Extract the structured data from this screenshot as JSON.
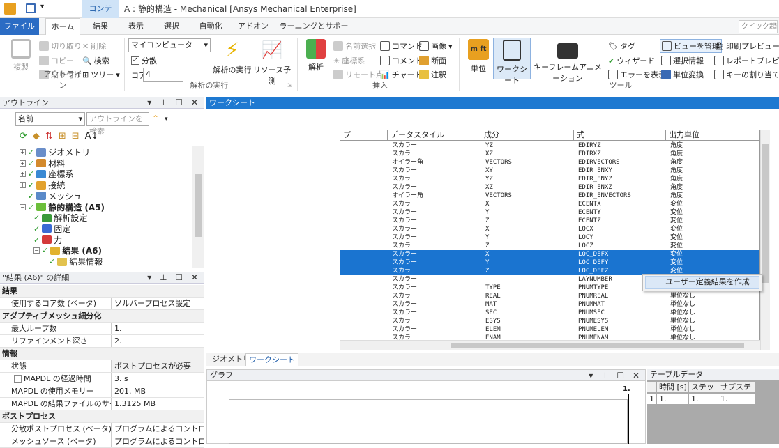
{
  "window": {
    "context_tab": "コンテキ...",
    "title": "A : 静的構造 - Mechanical [Ansys Mechanical Enterprise]"
  },
  "menu": {
    "tabs": [
      "ファイル",
      "ホーム",
      "結果",
      "表示",
      "選択",
      "自動化",
      "アドオン",
      "ラーニングとサポート"
    ],
    "active": "ホーム",
    "search_placeholder": "クイック起動"
  },
  "ribbon": {
    "outline": {
      "duplicate": "複製",
      "cut": "切り取り",
      "copy": "コピー",
      "paste": "貼り付け",
      "delete": "削除",
      "find": "検索",
      "tree": "ツリー",
      "group": "アウトライン"
    },
    "solve": {
      "target": "マイコンピュータ",
      "distributed": "分散",
      "cores_label": "コア",
      "cores": "4",
      "solve_btn": "解析の実行",
      "resource_btn": "リソース予測",
      "group": "解析の実行"
    },
    "insert": {
      "analysis": "解析",
      "named_sel": "名前選択",
      "coord": "座標系",
      "remote": "リモート点",
      "command": "コマンド",
      "comment": "コメント",
      "chart": "チャート",
      "image": "画像",
      "section": "断面",
      "annotation": "注釈",
      "group": "挿入"
    },
    "tools": {
      "unit": "単位",
      "worksheet": "ワークシート",
      "keyframe": "キーフレームアニメーション",
      "tag": "タグ",
      "wizard": "ウィザード",
      "show_errors": "エラーを表示",
      "manage_views": "ビューを管理",
      "sel_info": "選択情報",
      "unit_convert": "単位変換",
      "print_preview": "印刷プレビュー",
      "report_preview": "レポートプレビュー",
      "key_assign": "キーの割り当て",
      "group": "ツール"
    }
  },
  "outline": {
    "title": "アウトライン",
    "name_filter": "名前",
    "search_placeholder": "アウトラインを検索",
    "tree": [
      {
        "label": "ジオメトリ",
        "level": 1,
        "bold": false,
        "icon_color": "#6a8ec9"
      },
      {
        "label": "材料",
        "level": 1,
        "bold": false,
        "icon_color": "#d48a2c"
      },
      {
        "label": "座標系",
        "level": 1,
        "bold": false,
        "icon_color": "#3a8ad4"
      },
      {
        "label": "接続",
        "level": 1,
        "bold": false,
        "icon_color": "#e2a22e"
      },
      {
        "label": "メッシュ",
        "level": 1,
        "bold": false,
        "icon_color": "#5a8ac9"
      },
      {
        "label": "静的構造 (A5)",
        "level": 1,
        "bold": true,
        "icon_color": "#6cbf3a"
      },
      {
        "label": "解析設定",
        "level": 2,
        "bold": false,
        "icon_color": "#3a9a3a"
      },
      {
        "label": "固定",
        "level": 2,
        "bold": false,
        "icon_color": "#3a6ad4"
      },
      {
        "label": "力",
        "level": 2,
        "bold": false,
        "icon_color": "#d43a3a"
      },
      {
        "label": "結果 (A6)",
        "level": 2,
        "bold": true,
        "icon_color": "#e2b22e"
      },
      {
        "label": "結果情報",
        "level": 3,
        "bold": false,
        "icon_color": "#e2c24e"
      }
    ]
  },
  "details": {
    "title": "\"結果 (A6)\" の詳細",
    "rows": [
      {
        "type": "sec",
        "label": "結果"
      },
      {
        "type": "row",
        "k": "使用するコア数 (ベータ)",
        "v": "ソルバープロセス設定"
      },
      {
        "type": "sec",
        "label": "アダプティブメッシュ細分化"
      },
      {
        "type": "row",
        "k": "最大ループ数",
        "v": "1."
      },
      {
        "type": "row",
        "k": "リファインメント深さ",
        "v": "2."
      },
      {
        "type": "sec",
        "label": "情報"
      },
      {
        "type": "row",
        "k": "状態",
        "v": "ポストプロセスが必要",
        "hl": true
      },
      {
        "type": "row",
        "k": "MAPDL の経過時間",
        "v": "3. s",
        "check": true
      },
      {
        "type": "row",
        "k": "MAPDL の使用メモリー",
        "v": "201. MB"
      },
      {
        "type": "row",
        "k": "MAPDL の結果ファイルのサイズ",
        "v": "1.3125 MB"
      },
      {
        "type": "sec",
        "label": "ポストプロセス"
      },
      {
        "type": "row",
        "k": "分散ポストプロセス (ベータ)",
        "v": "プログラムによるコントロール"
      },
      {
        "type": "row",
        "k": "メッシュソース (ベータ)",
        "v": "プログラムによるコントロール"
      }
    ]
  },
  "worksheet": {
    "title": "ワークシート",
    "columns": [
      "プ",
      "データスタイル",
      "成分",
      "式",
      "出力単位"
    ],
    "rows": [
      {
        "style": "スカラー",
        "comp": "YZ",
        "expr": "EDIRYZ",
        "unit": "角度"
      },
      {
        "style": "スカラー",
        "comp": "XZ",
        "expr": "EDIRXZ",
        "unit": "角度"
      },
      {
        "style": "オイラー角",
        "comp": "VECTORS",
        "expr": "EDIRVECTORS",
        "unit": "角度"
      },
      {
        "style": "スカラー",
        "comp": "XY",
        "expr": "EDIR_ENXY",
        "unit": "角度"
      },
      {
        "style": "スカラー",
        "comp": "YZ",
        "expr": "EDIR_ENYZ",
        "unit": "角度"
      },
      {
        "style": "スカラー",
        "comp": "XZ",
        "expr": "EDIR_ENXZ",
        "unit": "角度"
      },
      {
        "style": "オイラー角",
        "comp": "VECTORS",
        "expr": "EDIR_ENVECTORS",
        "unit": "角度"
      },
      {
        "style": "スカラー",
        "comp": "X",
        "expr": "ECENTX",
        "unit": "変位"
      },
      {
        "style": "スカラー",
        "comp": "Y",
        "expr": "ECENTY",
        "unit": "変位"
      },
      {
        "style": "スカラー",
        "comp": "Z",
        "expr": "ECENTZ",
        "unit": "変位"
      },
      {
        "style": "スカラー",
        "comp": "X",
        "expr": "LOCX",
        "unit": "変位"
      },
      {
        "style": "スカラー",
        "comp": "Y",
        "expr": "LOCY",
        "unit": "変位"
      },
      {
        "style": "スカラー",
        "comp": "Z",
        "expr": "LOCZ",
        "unit": "変位"
      },
      {
        "style": "スカラー",
        "comp": "X",
        "expr": "LOC_DEFX",
        "unit": "変位",
        "selected": true
      },
      {
        "style": "スカラー",
        "comp": "Y",
        "expr": "LOC_DEFY",
        "unit": "変位",
        "selected": true
      },
      {
        "style": "スカラー",
        "comp": "Z",
        "expr": "LOC_DEFZ",
        "unit": "変位",
        "selected": true
      },
      {
        "style": "スカラー",
        "comp": "",
        "expr": "LAYNUMBER",
        "unit": ""
      },
      {
        "style": "スカラー",
        "comp": "TYPE",
        "expr": "PNUMTYPE",
        "unit": ""
      },
      {
        "style": "スカラー",
        "comp": "REAL",
        "expr": "PNUMREAL",
        "unit": "単位なし"
      },
      {
        "style": "スカラー",
        "comp": "MAT",
        "expr": "PNUMMAT",
        "unit": "単位なし"
      },
      {
        "style": "スカラー",
        "comp": "SEC",
        "expr": "PNUMSEC",
        "unit": "単位なし"
      },
      {
        "style": "スカラー",
        "comp": "ESYS",
        "expr": "PNUMESYS",
        "unit": "単位なし"
      },
      {
        "style": "スカラー",
        "comp": "ELEM",
        "expr": "PNUMELEM",
        "unit": "単位なし"
      },
      {
        "style": "スカラー",
        "comp": "ENAM",
        "expr": "PNUMENAM",
        "unit": "単位なし"
      }
    ],
    "context_menu": "ユーザー定義結果を作成"
  },
  "bottom_tabs": [
    "ジオメトリ",
    "ワークシート"
  ],
  "graph": {
    "title": "グラフ",
    "value_label": "1."
  },
  "table_data": {
    "title": "テーブルデータ",
    "columns": [
      "時間 [s]",
      "ステップ",
      "サブステップ"
    ],
    "row": [
      "1",
      "1.",
      "1.",
      "1."
    ]
  }
}
